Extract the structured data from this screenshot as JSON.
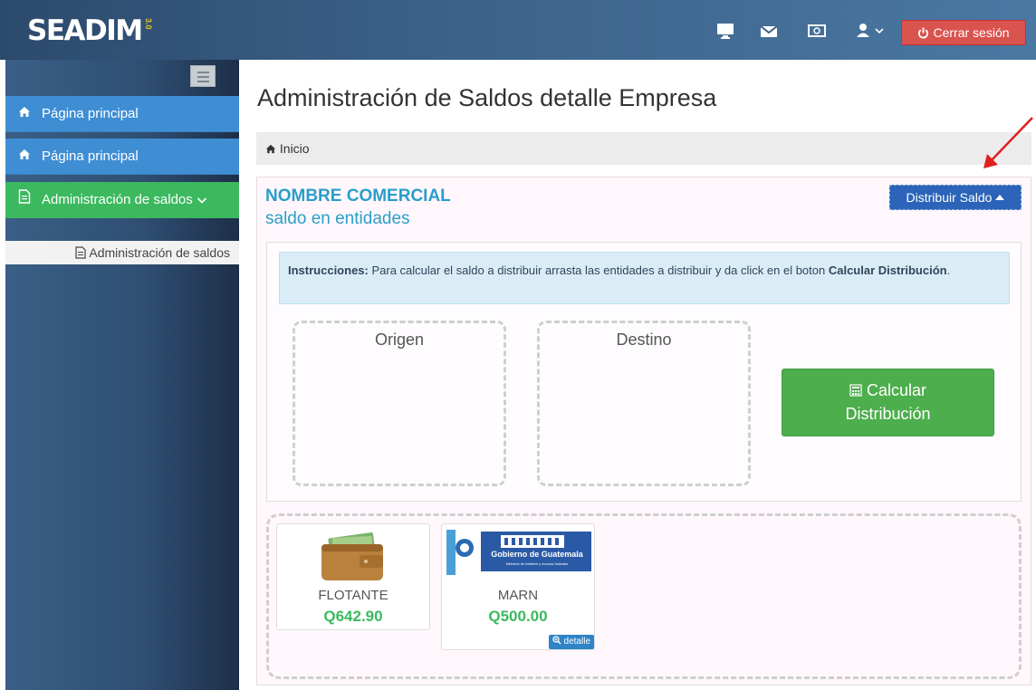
{
  "topbar": {
    "brand": "SEADIM",
    "brand_suffix": "3.0",
    "icons": [
      "monitor-icon",
      "envelope-icon",
      "money-icon",
      "user-icon"
    ],
    "logout_label": "Cerrar sesión"
  },
  "sidebar": {
    "items": [
      {
        "label": "Página principal",
        "icon": "home-icon"
      },
      {
        "label": "Página principal",
        "icon": "home-icon"
      },
      {
        "label": "Administración de saldos",
        "icon": "document-icon"
      }
    ],
    "sub_items": [
      {
        "label": "Administración de saldos",
        "icon": "document-icon"
      }
    ]
  },
  "main": {
    "title": "Administración de Saldos detalle Empresa",
    "breadcrumb": "Inicio",
    "company_name": "NOMBRE COMERCIAL",
    "subtitle": "saldo en entidades",
    "distribute_button": "Distribuir Saldo",
    "instructions_label": "Instrucciones:",
    "instructions_text": " Para calcular el saldo a distribuir arrasta las entidades a distribuir y da click en el boton ",
    "instructions_strong": "Calcular Distribución",
    "instructions_end": ".",
    "origin_label": "Origen",
    "destination_label": "Destino",
    "calculate_button_line1": "Calcular",
    "calculate_button_line2": "Distribución",
    "entities": [
      {
        "name": "FLOTANTE",
        "amount": "Q642.90",
        "logo": "wallet-icon"
      },
      {
        "name": "MARN",
        "amount": "Q500.00",
        "logo": "gobierno-guatemala-logo",
        "logo_text": "Gobierno de Guatemala",
        "logo_subtext": "Ministerio de Ambiente y recursos Naturales",
        "detail_label": "detalle"
      }
    ]
  },
  "colors": {
    "accent_blue": "#2a9ec9",
    "sidebar_blue": "#3f8ed4",
    "sidebar_green": "#3cb95f",
    "logout_red": "#d9534f",
    "amount_green": "#3cb95f",
    "annotation_red": "#e02020"
  }
}
